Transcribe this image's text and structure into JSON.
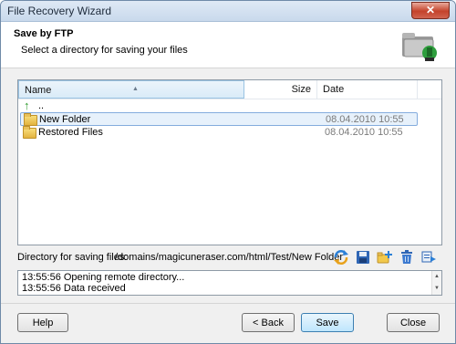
{
  "window": {
    "title": "File Recovery Wizard",
    "close_glyph": "✕"
  },
  "header": {
    "title": "Save by FTP",
    "subtitle": "Select a directory for saving your files",
    "icon": "folder-network-icon"
  },
  "filelist": {
    "columns": {
      "name": "Name",
      "size": "Size",
      "date": "Date"
    },
    "parent_label": "..",
    "rows": [
      {
        "name": "New Folder",
        "date": "08.04.2010 10:55",
        "selected": true
      },
      {
        "name": "Restored Files",
        "date": "08.04.2010 10:55",
        "selected": false
      }
    ]
  },
  "directory": {
    "label": "Directory for saving files:",
    "value": "/domains/magicuneraser.com/html/Test/New Folder"
  },
  "toolbar": [
    "refresh-icon",
    "save-icon",
    "new-folder-icon",
    "delete-icon",
    "properties-icon"
  ],
  "log": {
    "lines": [
      "13:55:56 Opening remote directory...",
      "13:55:56 Data received"
    ]
  },
  "buttons": {
    "help": "Help",
    "back": "< Back",
    "save": "Save",
    "close": "Close"
  },
  "colors": {
    "selection": "#e7f1fb",
    "selection_border": "#84acdd",
    "close_button": "#c4422b"
  }
}
